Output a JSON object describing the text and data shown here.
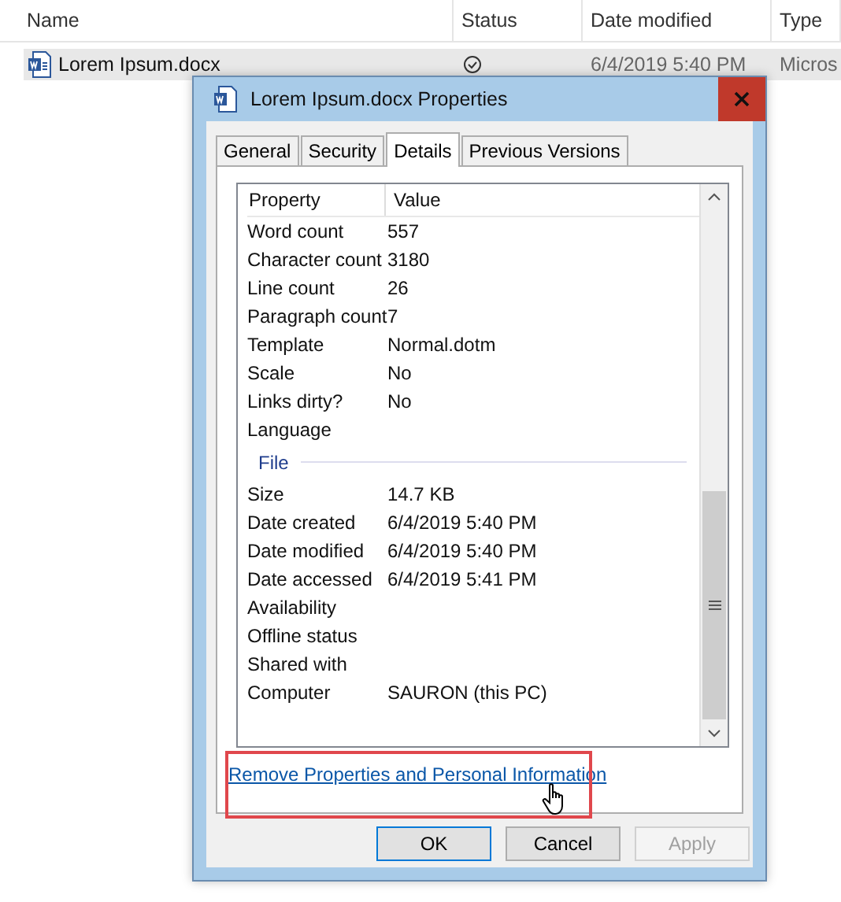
{
  "explorer": {
    "columns": [
      "Name",
      "Status",
      "Date modified",
      "Type"
    ],
    "files": [
      {
        "name": "Lorem Ipsum.docx",
        "selected": true,
        "date_modified": "6/4/2019 5:40 PM",
        "type": "Micros"
      }
    ]
  },
  "dialog": {
    "title": "Lorem Ipsum.docx Properties",
    "tabs": [
      {
        "label": "General",
        "selected": false
      },
      {
        "label": "Security",
        "selected": false
      },
      {
        "label": "Details",
        "selected": true
      },
      {
        "label": "Previous Versions",
        "selected": false
      }
    ],
    "list": {
      "columns": [
        "Property",
        "Value"
      ],
      "rows": [
        {
          "kind": "property",
          "property": "Word count",
          "value": "557"
        },
        {
          "kind": "property",
          "property": "Character count",
          "value": "3180"
        },
        {
          "kind": "property",
          "property": "Line count",
          "value": "26"
        },
        {
          "kind": "property",
          "property": "Paragraph count",
          "value": "7"
        },
        {
          "kind": "property",
          "property": "Template",
          "value": "Normal.dotm"
        },
        {
          "kind": "property",
          "property": "Scale",
          "value": "No"
        },
        {
          "kind": "property",
          "property": "Links dirty?",
          "value": "No"
        },
        {
          "kind": "property",
          "property": "Language"
        },
        {
          "kind": "section",
          "property": "File"
        },
        {
          "kind": "property",
          "property": "Size",
          "value": "14.7 KB"
        },
        {
          "kind": "property",
          "property": "Date created",
          "value": "6/4/2019 5:40 PM"
        },
        {
          "kind": "property",
          "property": "Date modified",
          "value": "6/4/2019 5:40 PM"
        },
        {
          "kind": "property",
          "property": "Date accessed",
          "value": "6/4/2019 5:41 PM"
        },
        {
          "kind": "property",
          "property": "Availability"
        },
        {
          "kind": "property",
          "property": "Offline status"
        },
        {
          "kind": "property",
          "property": "Shared with"
        },
        {
          "kind": "property",
          "property": "Computer",
          "value": "SAURON (this PC)"
        }
      ]
    },
    "link": "Remove Properties and Personal Information",
    "buttons": [
      {
        "label": "OK",
        "disabled": false,
        "default": true
      },
      {
        "label": "Cancel",
        "disabled": false,
        "default": false
      },
      {
        "label": "Apply",
        "disabled": true,
        "default": false
      }
    ]
  }
}
